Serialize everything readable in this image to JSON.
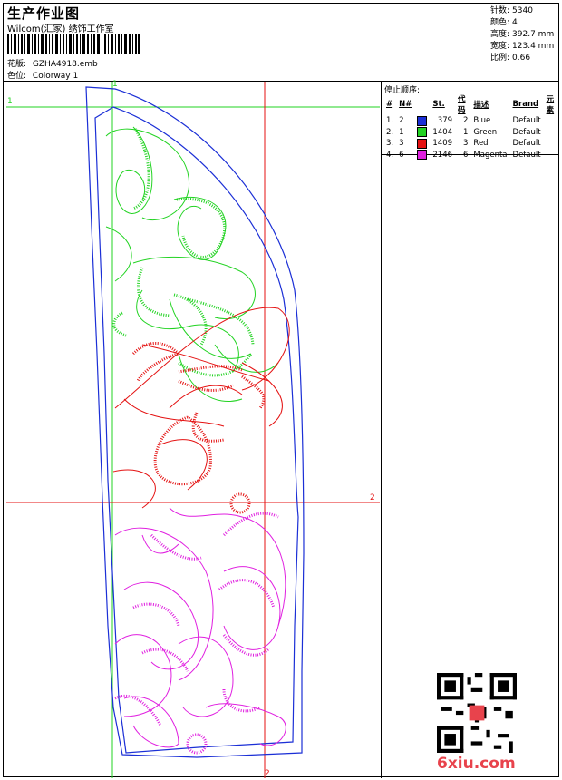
{
  "header": {
    "title": "生产作业图",
    "company": "Wilcom(汇家) 绣饰工作室",
    "design_label": "花版:",
    "design_value": "GZHA4918.emb",
    "colorway_label": "色位:",
    "colorway_value": "Colorway 1"
  },
  "stats": [
    {
      "label": "针数:",
      "value": "5340"
    },
    {
      "label": "颜色:",
      "value": "4"
    },
    {
      "label": "高度:",
      "value": "392.7 mm"
    },
    {
      "label": "宽度:",
      "value": "123.4 mm"
    },
    {
      "label": "比例:",
      "value": "0.66"
    }
  ],
  "stop_sequence": {
    "title": "停止顺序:",
    "headers": [
      "#",
      "N#",
      "St.",
      "代码",
      "描述",
      "Brand",
      "元素"
    ],
    "rows": [
      {
        "idx": "1.",
        "n": "2",
        "st": "379",
        "code": "2",
        "desc": "Blue",
        "brand": "Default",
        "color": "#1b2fd6"
      },
      {
        "idx": "2.",
        "n": "1",
        "st": "1404",
        "code": "1",
        "desc": "Green",
        "brand": "Default",
        "color": "#22d322"
      },
      {
        "idx": "3.",
        "n": "3",
        "st": "1409",
        "code": "3",
        "desc": "Red",
        "brand": "Default",
        "color": "#e41111"
      },
      {
        "idx": "4.",
        "n": "6",
        "st": "2146",
        "code": "6",
        "desc": "Magenta",
        "brand": "Default",
        "color": "#e020e0"
      }
    ]
  },
  "guides": {
    "green_label": "1",
    "red_label": "2"
  },
  "logo": "6xiu.com",
  "colors": {
    "blue": "#1b2fd6",
    "green": "#22d322",
    "red": "#e41111",
    "magenta": "#e020e0"
  }
}
